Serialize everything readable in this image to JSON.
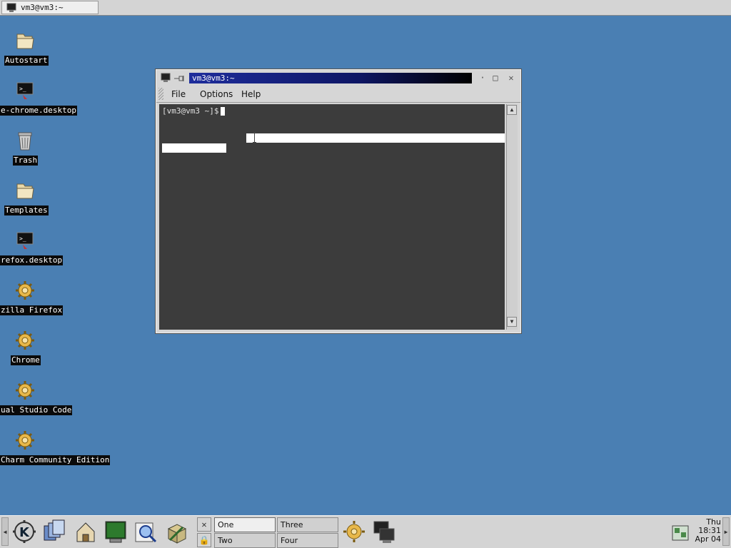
{
  "top_taskbar": {
    "task_title": "vm3@vm3:~"
  },
  "desktop": {
    "icons": [
      {
        "label": "Autostart",
        "icon": "folder-icon"
      },
      {
        "label": "e-chrome.desktop",
        "icon": "terminal-launcher-icon"
      },
      {
        "label": "Trash",
        "icon": "trash-icon"
      },
      {
        "label": "Templates",
        "icon": "folder-icon"
      },
      {
        "label": "refox.desktop",
        "icon": "terminal-launcher-icon"
      },
      {
        "label": "zilla Firefox",
        "icon": "gear-app-icon"
      },
      {
        "label": "Chrome",
        "icon": "gear-app-icon"
      },
      {
        "label": "ual Studio Code",
        "icon": "gear-app-icon"
      },
      {
        "label": "Charm Community Edition",
        "icon": "gear-app-icon"
      }
    ]
  },
  "terminal": {
    "title": "vm3@vm3:~",
    "menus": [
      {
        "label": "File"
      },
      {
        "label": "Options"
      },
      {
        "label": "Help"
      }
    ],
    "prompt": "[vm3@vm3 ~]$"
  },
  "taskbar": {
    "desktops": [
      {
        "label": "One",
        "active": true
      },
      {
        "label": "Two",
        "active": false
      },
      {
        "label": "Three",
        "active": false
      },
      {
        "label": "Four",
        "active": false
      }
    ],
    "clock": {
      "day": "Thu",
      "time": "18:31",
      "date": "Apr 04"
    }
  },
  "colors": {
    "desktop_bg": "#4a7fb3",
    "terminal_bg": "#3c3c3c",
    "title_active": "#1e2d9c"
  }
}
